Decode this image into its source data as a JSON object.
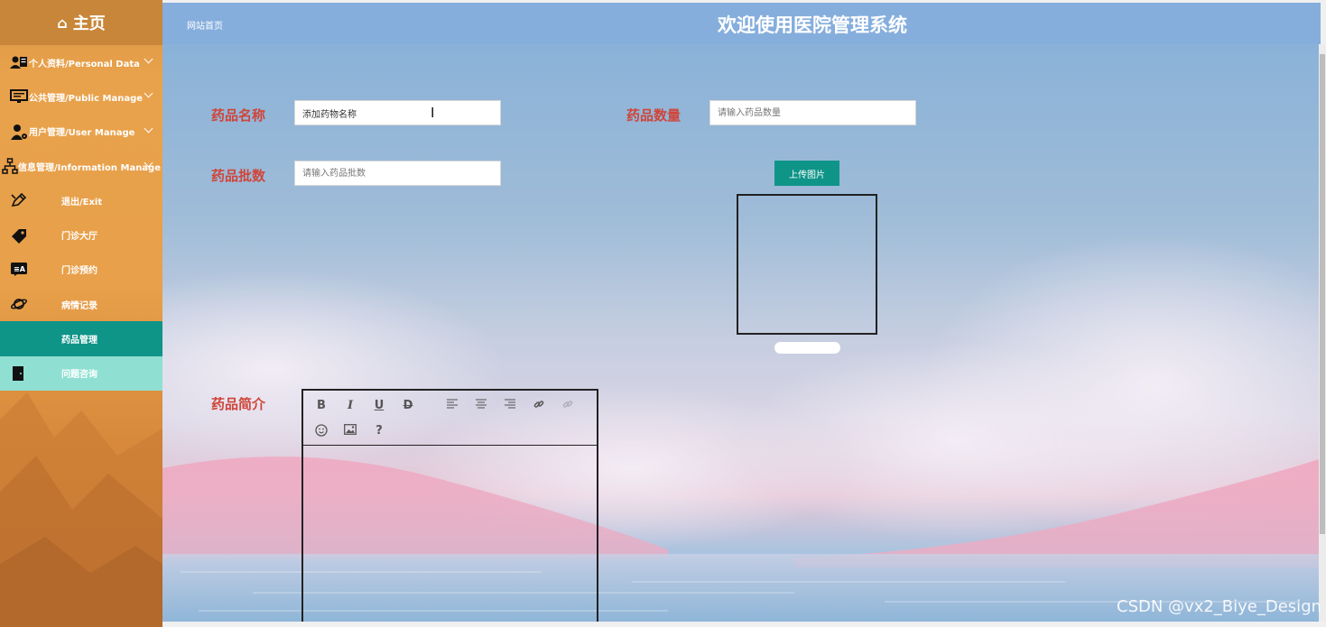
{
  "header": {
    "home_label": "主页",
    "breadcrumb": "网站首页",
    "title": "欢迎使用医院管理系统"
  },
  "sidebar": {
    "items": [
      {
        "label": "个人资料/Personal Data",
        "icon": "user-card-icon"
      },
      {
        "label": "公共管理/Public Manage",
        "icon": "monitor-icon"
      },
      {
        "label": "用户管理/User Manage",
        "icon": "user-gear-icon"
      },
      {
        "label": "信息管理/Information Manage",
        "icon": "network-icon"
      },
      {
        "label": "退出/Exit",
        "icon": "edit-pencil-icon"
      },
      {
        "label": "门诊大厅",
        "icon": "tag-icon"
      },
      {
        "label": "门诊预约",
        "icon": "translate-icon"
      },
      {
        "label": "病情记录",
        "icon": "planet-icon"
      },
      {
        "label": "药品管理",
        "icon": "none"
      },
      {
        "label": "问题咨询",
        "icon": "door-icon"
      }
    ]
  },
  "form": {
    "name_label": "药品名称",
    "name_value": "添加药物名称",
    "qty_label": "药品数量",
    "qty_placeholder": "请输入药品数量",
    "batch_label": "药品批数",
    "batch_placeholder": "请输入药品批数",
    "upload_label": "上传图片",
    "intro_label": "药品简介"
  },
  "editor_tools": [
    "B",
    "I",
    "U",
    "D",
    "align-left",
    "align-center",
    "align-right",
    "link",
    "unlink",
    "emoji",
    "image",
    "?"
  ],
  "watermark": "CSDN @vx2_Biye_Design",
  "colors": {
    "sidebar": "#e8a04a",
    "active": "#0f9488",
    "hover": "#8fe0d2",
    "topbar": "#85aedc",
    "label": "#d0453a"
  }
}
